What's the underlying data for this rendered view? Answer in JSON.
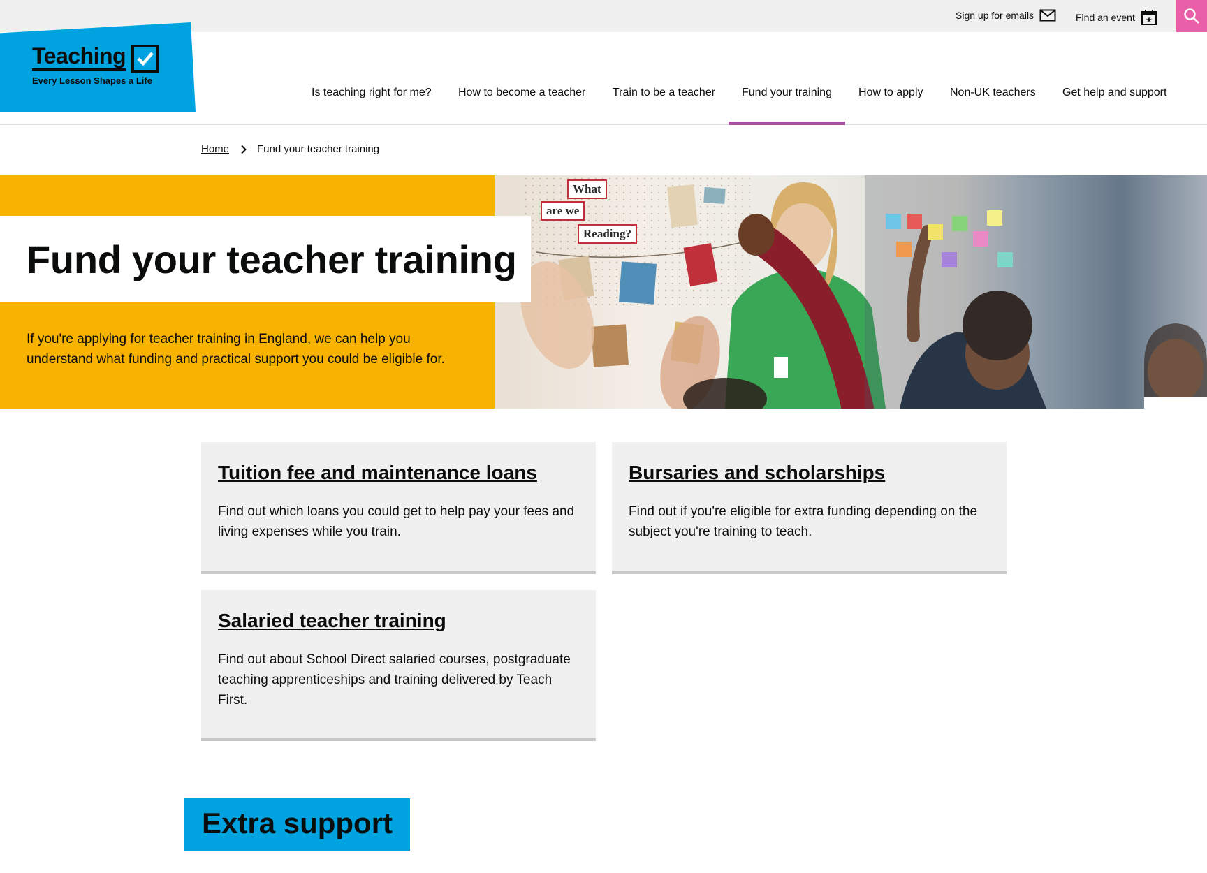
{
  "utility": {
    "signup_label": "Sign up for emails",
    "event_label": "Find an event"
  },
  "logo": {
    "word": "Teaching",
    "tagline": "Every Lesson Shapes a Life"
  },
  "nav": {
    "items": [
      "Is teaching right for me?",
      "How to become a teacher",
      "Train to be a teacher",
      "Fund your training",
      "How to apply",
      "Non-UK teachers",
      "Get help and support"
    ],
    "active": "Fund your training"
  },
  "breadcrumb": {
    "home": "Home",
    "current": "Fund your teacher training"
  },
  "hero": {
    "title": "Fund your teacher training",
    "text": "If you're applying for teacher training in England, we can help you understand what funding and practical support you could be eligible for.",
    "image_signs": [
      "What",
      "are we",
      "Reading?"
    ]
  },
  "cards": [
    {
      "title": "Tuition fee and maintenance loans",
      "text": "Find out which loans you could get to help pay your fees and living expenses while you train."
    },
    {
      "title": "Bursaries and scholarships",
      "text": "Find out if you're eligible for extra funding depending on the subject you're training to teach."
    },
    {
      "title": "Salaried teacher training",
      "text": "Find out about School Direct salaried courses, postgraduate teaching apprenticeships and training delivered by Teach First."
    }
  ],
  "extra": {
    "heading": "Extra support"
  },
  "colors": {
    "brand_blue": "#00a3e0",
    "hero_yellow": "#f8b300",
    "search_pink": "#e85fa7",
    "nav_active": "#a8519f",
    "card_bg": "#f0f0f0"
  },
  "icons": [
    "mail-icon",
    "calendar-icon",
    "search-icon",
    "checkmark-icon",
    "chevron-right-icon"
  ]
}
